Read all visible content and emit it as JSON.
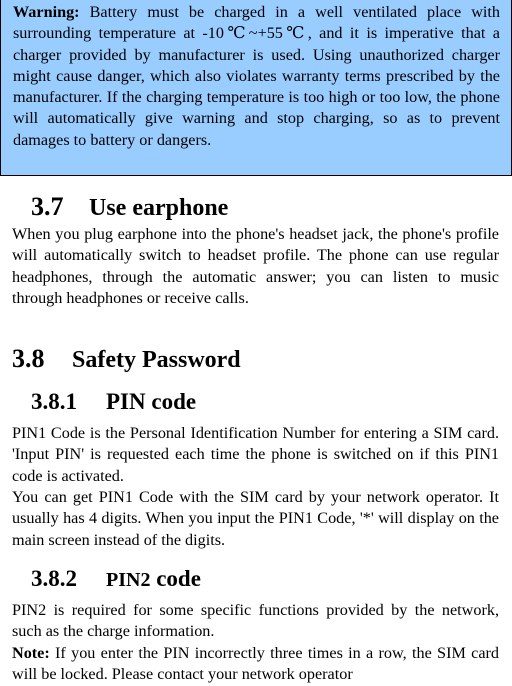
{
  "warning": {
    "label": "Warning:",
    "text": " Battery must be charged in a well ventilated place with surrounding temperature at -10℃~+55℃, and it is imperative that a charger provided by manufacturer is used. Using unauthorized charger might cause danger, which also violates warranty terms prescribed by the manufacturer. If the charging temperature is too high or too low, the phone will automatically give warning and stop charging, so as to prevent damages to battery or dangers.",
    "background_color": "#99ccff"
  },
  "sections": {
    "s37": {
      "number": "3.7",
      "title": "Use earphone",
      "body": "When you plug earphone into the phone's headset jack, the phone's profile will automatically switch to headset profile. The phone can use regular headphones, through the automatic answer; you can listen to music through headphones or receive calls."
    },
    "s38": {
      "number": "3.8",
      "title": "Safety Password"
    },
    "s381": {
      "number": "3.8.1",
      "title": "PIN code",
      "body1": "PIN1 Code is the Personal Identification Number for entering a SIM card. 'Input PIN' is requested each time the phone is switched on if this PIN1 code is activated.",
      "body2": "You can get PIN1 Code with the SIM card by your network operator. It usually has 4 digits. When you input the PIN1 Code, '*' will display on the main screen instead of the digits."
    },
    "s382": {
      "number": "3.8.2",
      "title_prefix": "PIN2",
      "title_suffix": " code",
      "body1": "PIN2 is required for some specific functions provided by the network, such as the charge information.",
      "note_label": "Note:",
      "note_text": " If you enter the PIN incorrectly three times in a row, the SIM card will be locked. Please contact your network operator"
    }
  }
}
